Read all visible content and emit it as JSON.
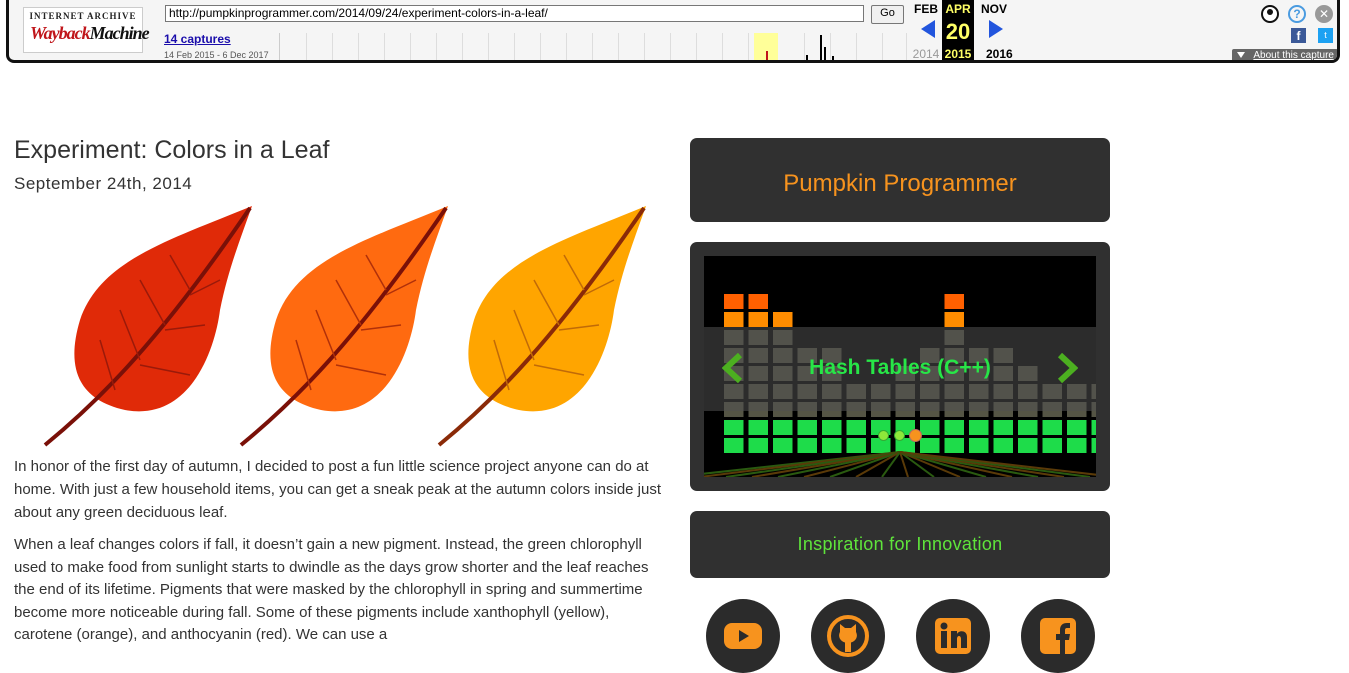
{
  "wayback": {
    "logo_top": "INTERNET ARCHIVE",
    "logo_main_a": "Wayback",
    "logo_main_b": "Machine",
    "url": "http://pumpkinprogrammer.com/2014/09/24/experiment-colors-in-a-leaf/",
    "go_label": "Go",
    "captures": "14 captures",
    "date_range": "14 Feb 2015 - 6 Dec 2017",
    "month_prev": "FEB",
    "month_cur": "APR",
    "month_next": "NOV",
    "day_cur": "20",
    "year_prev": "2014",
    "year_cur": "2015",
    "year_next": "2016",
    "about": "About this capture",
    "icons": [
      "user-icon",
      "help-icon",
      "close-icon",
      "facebook-icon",
      "twitter-icon"
    ]
  },
  "article": {
    "title": "Experiment: Colors in a Leaf",
    "date": "September 24th, 2014",
    "leaf_colors": [
      "#e02a08",
      "#ff6a10",
      "#ffa500"
    ],
    "paragraphs": [
      "In honor of the first day of autumn, I decided to post a fun little science project anyone can do at home. With just a few household items, you can get a sneak peak at the autumn colors inside just about any green deciduous leaf.",
      "When a leaf changes colors if fall, it doesn’t gain a new pigment. Instead, the green chlorophyll used to make food from sunlight starts to dwindle as the days grow shorter and the leaf reaches the end of its lifetime. Pigments that were masked by the chlorophyll in spring and summertime become more noticeable during fall. Some of these pigments include xanthophyll (yellow), carotene (orange), and anthocyanin (red). We can use a"
    ]
  },
  "sidebar": {
    "site_title": "Pumpkin Programmer",
    "slider_title": "Hash Tables (C++)",
    "slider_dots": 3,
    "slider_active_dot": 3,
    "tagline": "Inspiration for Innovation",
    "social": [
      "youtube-icon",
      "github-icon",
      "linkedin-icon",
      "facebook-icon"
    ],
    "colors": {
      "title": "#f7931e",
      "slider_title": "#27e647",
      "tagline": "#5fe43b",
      "box": "#303030"
    }
  }
}
